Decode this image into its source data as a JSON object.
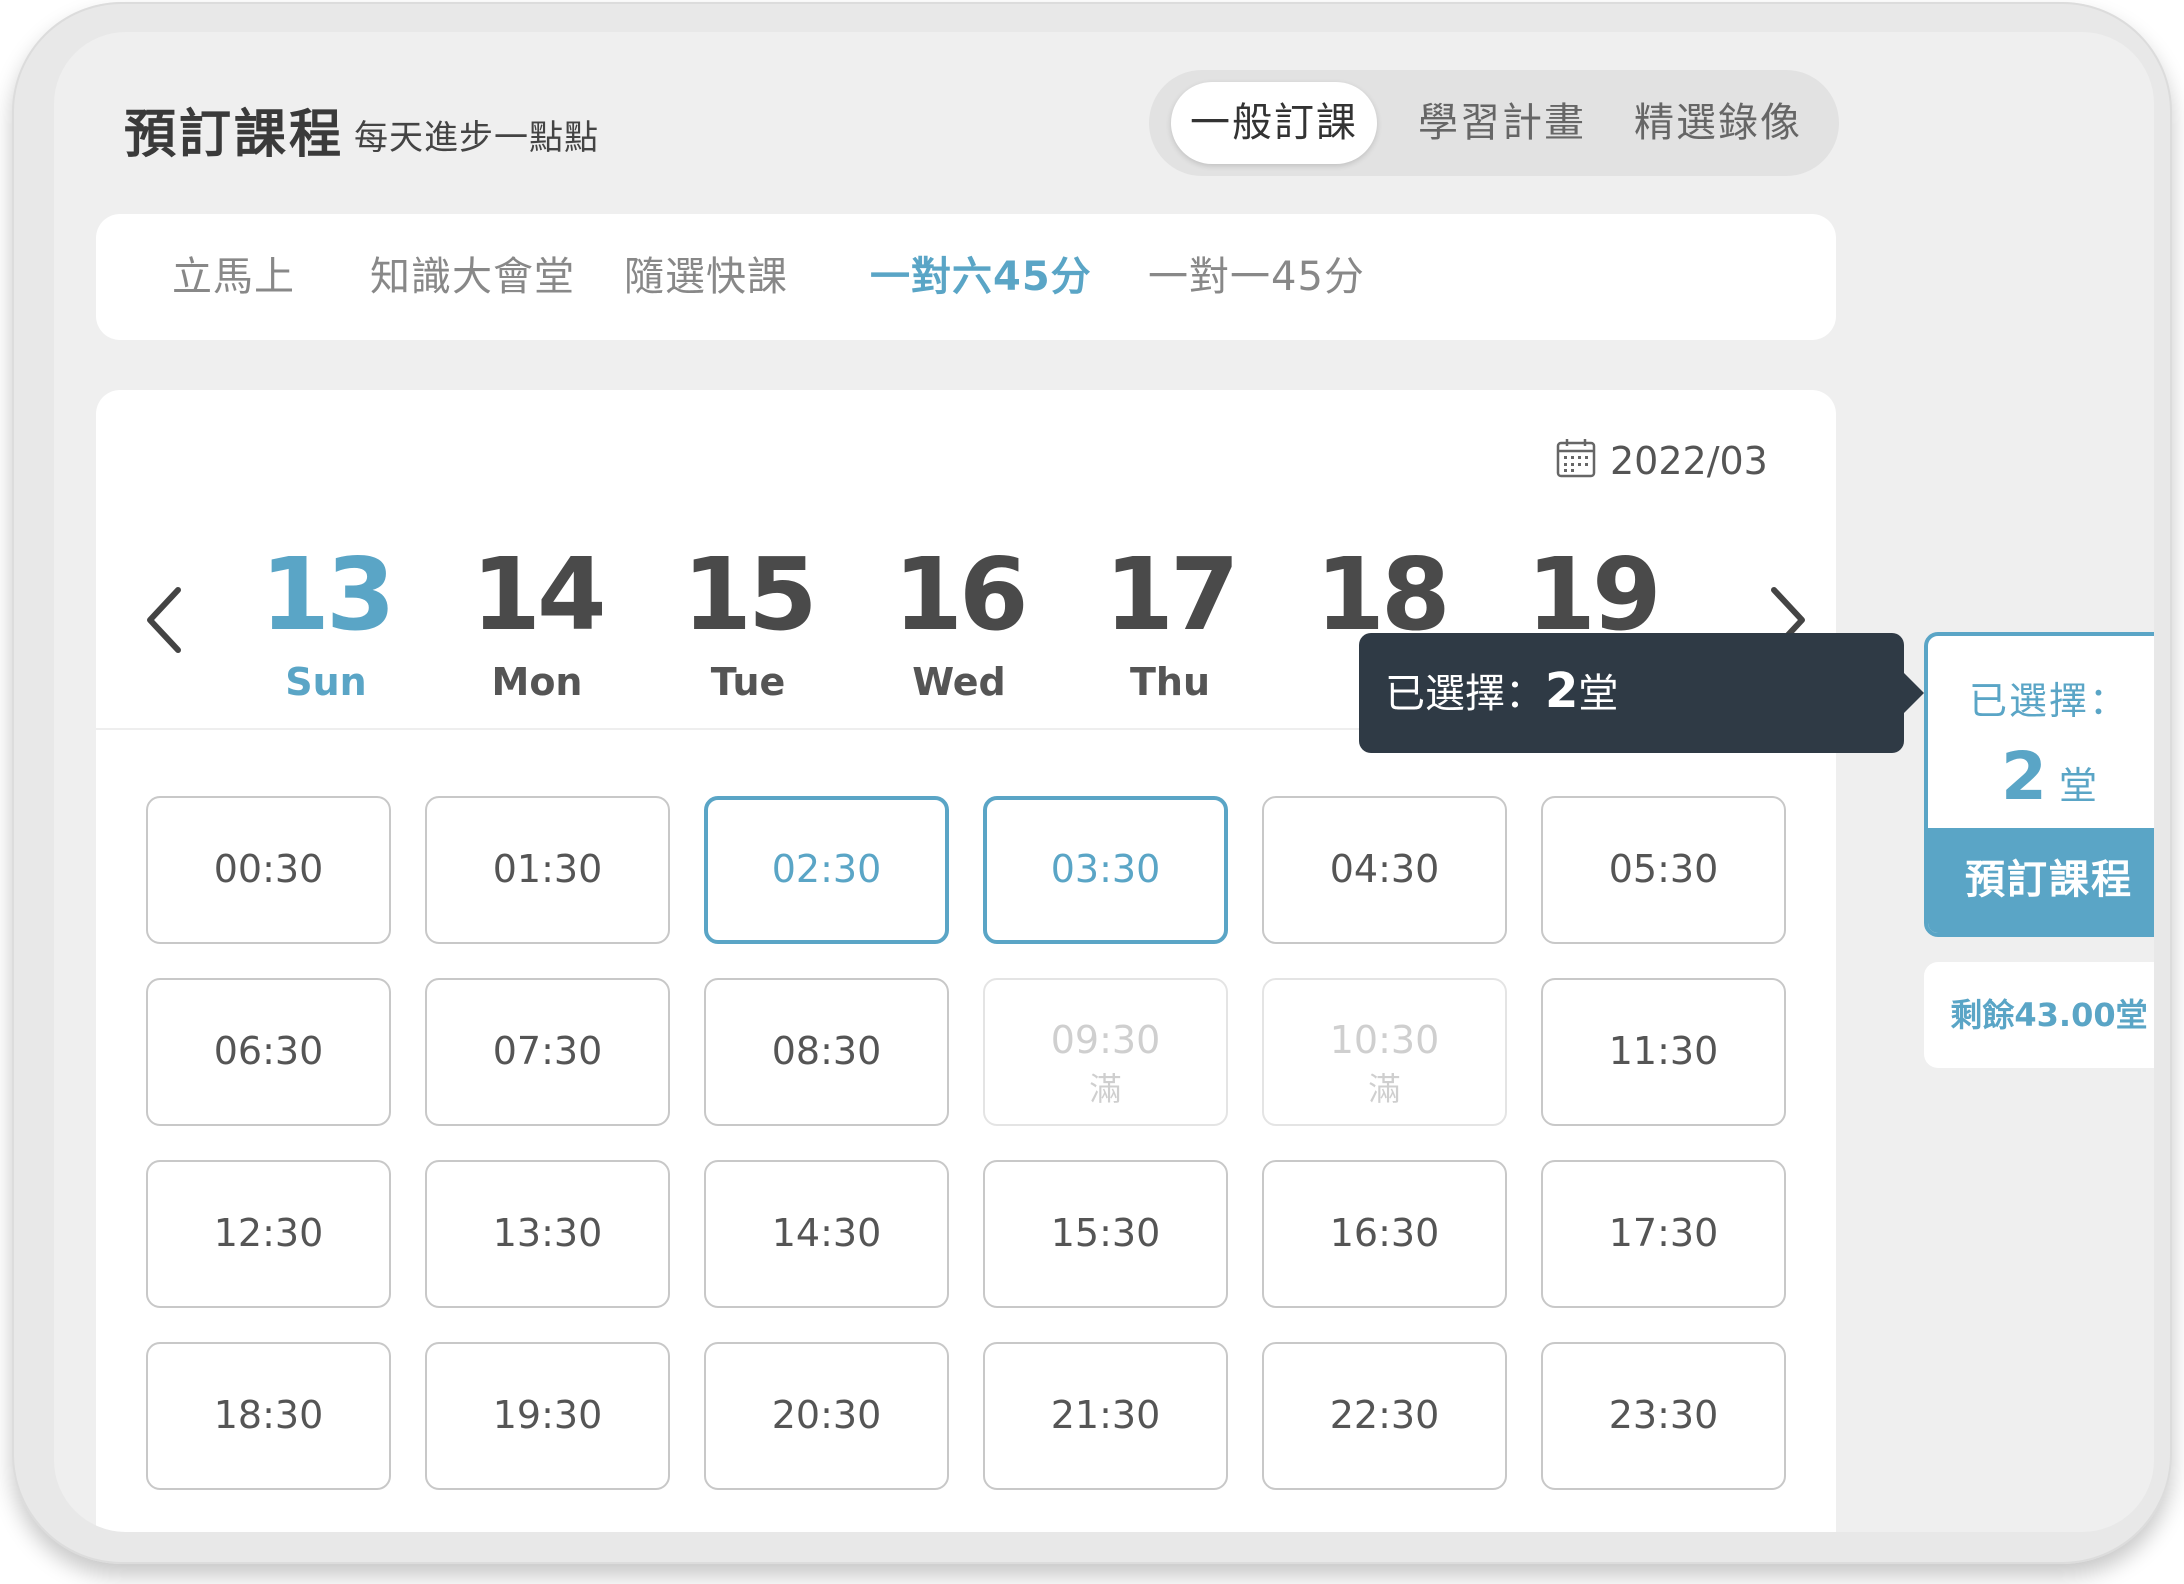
{
  "header": {
    "title": "預訂課程",
    "subtitle": "每天進步一點點",
    "segments": [
      {
        "label": "一般訂課",
        "active": true
      },
      {
        "label": "學習計畫",
        "active": false
      },
      {
        "label": "精選錄像",
        "active": false
      }
    ]
  },
  "tabs": [
    {
      "label": "立馬上",
      "active": false
    },
    {
      "label": "知識大會堂",
      "active": false
    },
    {
      "label": "隨選快課",
      "active": false
    },
    {
      "label": "一對六45分",
      "active": true
    },
    {
      "label": "一對一45分",
      "active": false
    }
  ],
  "calendar": {
    "month": "2022/03",
    "icon": "calendar-icon",
    "dates": [
      {
        "num": "13",
        "dow": "Sun",
        "active": true
      },
      {
        "num": "14",
        "dow": "Mon",
        "active": false
      },
      {
        "num": "15",
        "dow": "Tue",
        "active": false
      },
      {
        "num": "16",
        "dow": "Wed",
        "active": false
      },
      {
        "num": "17",
        "dow": "Thu",
        "active": false
      },
      {
        "num": "18",
        "dow": "",
        "active": false
      },
      {
        "num": "19",
        "dow": "",
        "active": false
      }
    ]
  },
  "slots": [
    {
      "time": "00:30",
      "state": "available"
    },
    {
      "time": "01:30",
      "state": "available"
    },
    {
      "time": "02:30",
      "state": "selected"
    },
    {
      "time": "03:30",
      "state": "selected"
    },
    {
      "time": "04:30",
      "state": "available"
    },
    {
      "time": "05:30",
      "state": "available"
    },
    {
      "time": "06:30",
      "state": "available"
    },
    {
      "time": "07:30",
      "state": "available"
    },
    {
      "time": "08:30",
      "state": "available"
    },
    {
      "time": "09:30",
      "state": "full",
      "note": "滿"
    },
    {
      "time": "10:30",
      "state": "full",
      "note": "滿"
    },
    {
      "time": "11:30",
      "state": "available"
    },
    {
      "time": "12:30",
      "state": "available"
    },
    {
      "time": "13:30",
      "state": "available"
    },
    {
      "time": "14:30",
      "state": "available"
    },
    {
      "time": "15:30",
      "state": "available"
    },
    {
      "time": "16:30",
      "state": "available"
    },
    {
      "time": "17:30",
      "state": "available"
    },
    {
      "time": "18:30",
      "state": "available"
    },
    {
      "time": "19:30",
      "state": "available"
    },
    {
      "time": "20:30",
      "state": "available"
    },
    {
      "time": "21:30",
      "state": "available"
    },
    {
      "time": "22:30",
      "state": "available"
    },
    {
      "time": "23:30",
      "state": "available"
    }
  ],
  "tooltip": {
    "label": "已選擇：",
    "count": "2",
    "unit": "堂"
  },
  "summary": {
    "label": "已選擇：",
    "count": "2",
    "unit": "堂",
    "book_label": "預訂課程",
    "remaining": "剩餘43.00堂"
  },
  "colors": {
    "accent": "#5aa5c6",
    "tooltip_bg": "#2f3a45",
    "screen_bg": "#efefef"
  }
}
